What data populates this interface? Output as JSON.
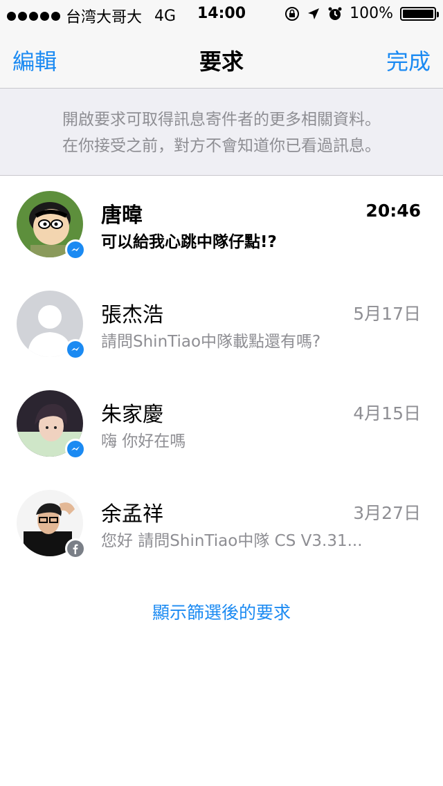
{
  "status_bar": {
    "carrier": "台湾大哥大",
    "network": "4G",
    "time": "14:00",
    "battery": "100%"
  },
  "nav": {
    "left_label": "編輯",
    "title": "要求",
    "right_label": "完成"
  },
  "banner": {
    "line1": "開啟要求可取得訊息寄件者的更多相關資料。",
    "line2": "在你接受之前，對方不會知道你已看過訊息。"
  },
  "requests": [
    {
      "name": "唐暐",
      "message": "可以給我心跳中隊仔點!?",
      "date": "20:46",
      "unread": true,
      "badge": "messenger-icon"
    },
    {
      "name": "張杰浩",
      "message": "請問ShinTiao中隊載點還有嗎?",
      "date": "5月17日",
      "unread": false,
      "badge": "messenger-icon"
    },
    {
      "name": "朱家慶",
      "message": "嗨 你好在嗎",
      "date": "4月15日",
      "unread": false,
      "badge": "messenger-icon"
    },
    {
      "name": "余孟祥",
      "message": "您好 請問ShinTiao中隊 CS V3.31...",
      "date": "3月27日",
      "unread": false,
      "badge": "facebook-icon"
    }
  ],
  "filter_link": "顯示篩選後的要求",
  "colors": {
    "accent": "#1b8af2",
    "secondary_text": "#8e8e93",
    "banner_bg": "#efeff4"
  }
}
